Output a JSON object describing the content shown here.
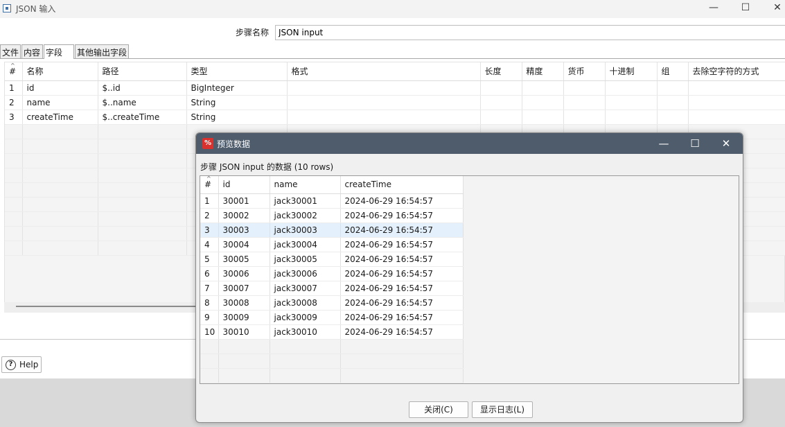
{
  "window": {
    "title": "JSON 输入",
    "minimize_glyph": "—",
    "maximize_glyph": "☐",
    "close_glyph": "✕"
  },
  "step": {
    "label": "步骤名称",
    "value": "JSON input"
  },
  "tabs": [
    {
      "label": "文件"
    },
    {
      "label": "内容"
    },
    {
      "label": "字段"
    },
    {
      "label": "其他输出字段"
    }
  ],
  "active_tab": "字段",
  "fields_table": {
    "headers": [
      "#",
      "名称",
      "路径",
      "类型",
      "格式",
      "长度",
      "精度",
      "货币",
      "十进制",
      "组",
      "去除空字符的方式"
    ],
    "rows": [
      [
        "1",
        "id",
        "$..id",
        "BigInteger"
      ],
      [
        "2",
        "name",
        "$..name",
        "String"
      ],
      [
        "3",
        "createTime",
        "$..createTime",
        "String"
      ]
    ]
  },
  "help_button": {
    "label": "Help",
    "icon": "?"
  },
  "dialog": {
    "title": "预览数据",
    "icon_glyph": "%",
    "caption": "步骤 JSON input 的数据  (10 rows)",
    "headers": [
      "#",
      "id",
      "name",
      "createTime"
    ],
    "rows": [
      [
        "1",
        "30001",
        "jack30001",
        "2024-06-29 16:54:57"
      ],
      [
        "2",
        "30002",
        "jack30002",
        "2024-06-29 16:54:57"
      ],
      [
        "3",
        "30003",
        "jack30003",
        "2024-06-29 16:54:57"
      ],
      [
        "4",
        "30004",
        "jack30004",
        "2024-06-29 16:54:57"
      ],
      [
        "5",
        "30005",
        "jack30005",
        "2024-06-29 16:54:57"
      ],
      [
        "6",
        "30006",
        "jack30006",
        "2024-06-29 16:54:57"
      ],
      [
        "7",
        "30007",
        "jack30007",
        "2024-06-29 16:54:57"
      ],
      [
        "8",
        "30008",
        "jack30008",
        "2024-06-29 16:54:57"
      ],
      [
        "9",
        "30009",
        "jack30009",
        "2024-06-29 16:54:57"
      ],
      [
        "10",
        "30010",
        "jack30010",
        "2024-06-29 16:54:57"
      ]
    ],
    "selected_row": "3",
    "close_button": "关闭(C)",
    "log_button": "显示日志(L)",
    "minimize_glyph": "—",
    "maximize_glyph": "☐",
    "close_glyph": "✕"
  },
  "colors": {
    "dialog_titlebar": "#4f5c6b",
    "selected_row": "#e4f0fb",
    "dialog_icon": "#d9322e"
  }
}
